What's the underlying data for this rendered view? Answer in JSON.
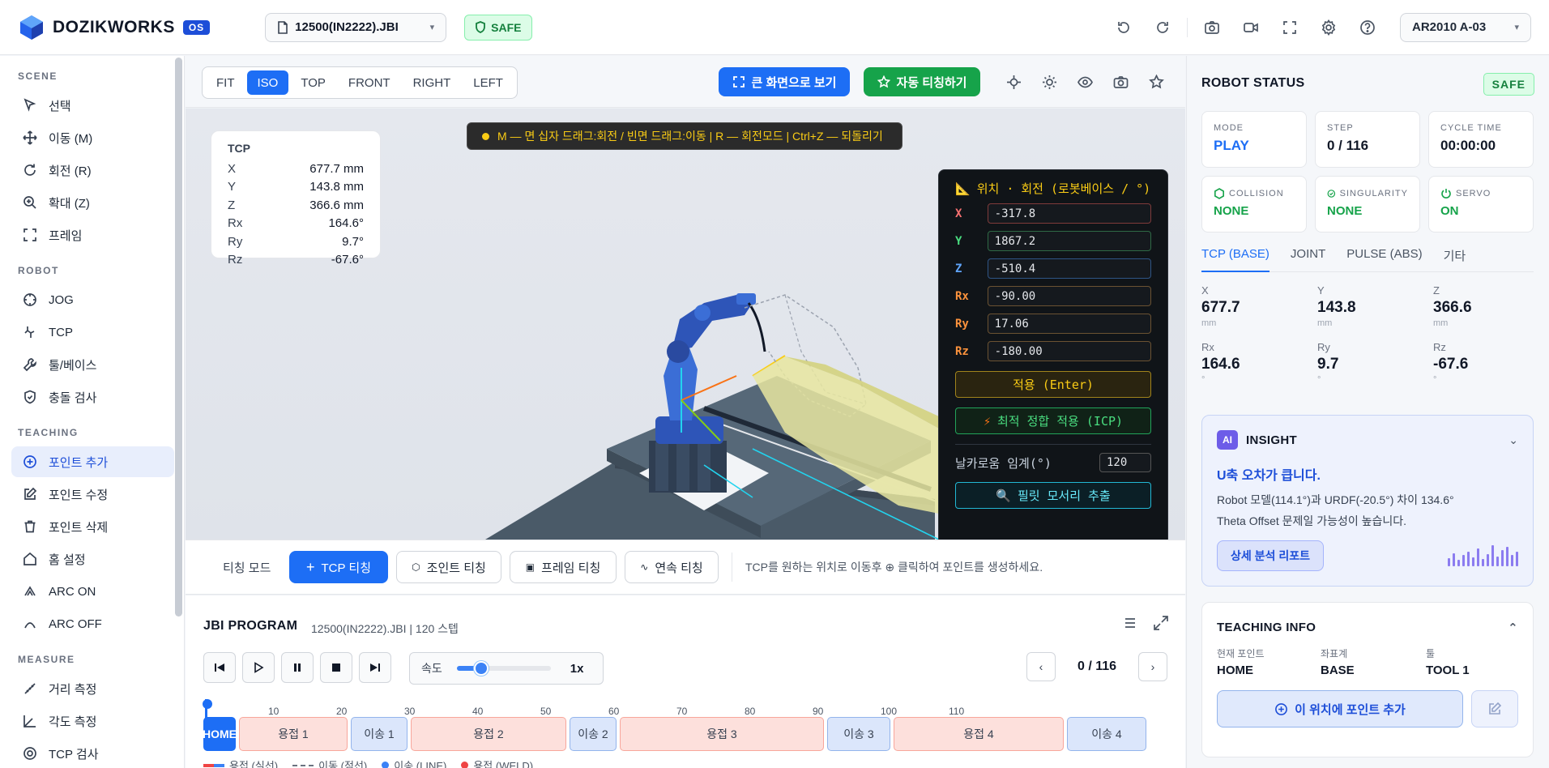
{
  "app": {
    "name": "DOZIKWORKS",
    "badge": "OS"
  },
  "header": {
    "file": "12500(IN2222).JBI",
    "status": "SAFE",
    "robot": "AR2010 A-03",
    "icons": [
      "undo-icon",
      "redo-icon",
      "camera-icon",
      "video-icon",
      "fullscreen-icon",
      "gear-icon",
      "help-icon"
    ]
  },
  "sidebar": {
    "sections": [
      {
        "title": "SCENE",
        "items": [
          {
            "label": "선택",
            "icon": "cursor-icon"
          },
          {
            "label": "이동 (M)",
            "icon": "move-icon"
          },
          {
            "label": "회전 (R)",
            "icon": "rotate-icon"
          },
          {
            "label": "확대 (Z)",
            "icon": "zoom-icon"
          },
          {
            "label": "프레임",
            "icon": "frame-icon"
          }
        ]
      },
      {
        "title": "ROBOT",
        "items": [
          {
            "label": "JOG",
            "icon": "crosshair-icon"
          },
          {
            "label": "TCP",
            "icon": "tcp-icon"
          },
          {
            "label": "툴/베이스",
            "icon": "wrench-icon"
          },
          {
            "label": "충돌 검사",
            "icon": "shield-icon"
          }
        ]
      },
      {
        "title": "TEACHING",
        "items": [
          {
            "label": "포인트 추가",
            "icon": "plus-circle-icon",
            "active": true
          },
          {
            "label": "포인트 수정",
            "icon": "edit-icon"
          },
          {
            "label": "포인트 삭제",
            "icon": "trash-icon"
          },
          {
            "label": "홈 설정",
            "icon": "home-icon"
          },
          {
            "label": "ARC ON",
            "icon": "arc-on-icon"
          },
          {
            "label": "ARC OFF",
            "icon": "arc-off-icon"
          }
        ]
      },
      {
        "title": "MEASURE",
        "items": [
          {
            "label": "거리 측정",
            "icon": "ruler-icon"
          },
          {
            "label": "각도 측정",
            "icon": "angle-icon"
          },
          {
            "label": "TCP 검사",
            "icon": "target-icon"
          }
        ]
      }
    ]
  },
  "view": {
    "tabs": [
      "FIT",
      "ISO",
      "TOP",
      "FRONT",
      "RIGHT",
      "LEFT"
    ],
    "active_tab": "ISO",
    "big_screen": "큰 화면으로 보기",
    "auto_teach": "자동 티칭하기",
    "hint": "M — 면 십자 드래그:회전 / 빈면 드래그:이동 | R — 회전모드 | Ctrl+Z — 되돌리기"
  },
  "tcp_card": {
    "title": "TCP",
    "rows": [
      {
        "k": "X",
        "v": "677.7 mm"
      },
      {
        "k": "Y",
        "v": "143.8 mm"
      },
      {
        "k": "Z",
        "v": "366.6 mm"
      },
      {
        "k": "Rx",
        "v": "164.6°"
      },
      {
        "k": "Ry",
        "v": "9.7°"
      },
      {
        "k": "Rz",
        "v": "-67.6°"
      }
    ]
  },
  "pose_panel": {
    "title": "위치 · 회전 (로봇베이스 / °)",
    "rows": [
      {
        "k": "X",
        "v": "-317.8",
        "color": "#f87171"
      },
      {
        "k": "Y",
        "v": "1867.2",
        "color": "#4ade80"
      },
      {
        "k": "Z",
        "v": "-510.4",
        "color": "#60a5fa"
      },
      {
        "k": "Rx",
        "v": "-90.00",
        "color": "#fb923c"
      },
      {
        "k": "Ry",
        "v": "17.06",
        "color": "#fb923c"
      },
      {
        "k": "Rz",
        "v": "-180.00",
        "color": "#fb923c"
      }
    ],
    "apply": "적용 (Enter)",
    "icp": "최적 정합 적용 (ICP)",
    "sharp_label": "날카로움 임계(°)",
    "sharp_value": "120",
    "extract": "필릿 모서리 추출"
  },
  "teach": {
    "mode_label": "티칭 모드",
    "buttons": [
      "TCP 티칭",
      "조인트 티칭",
      "프레임 티칭",
      "연속 티칭"
    ],
    "hint": "TCP를 원하는 위치로 이동후 ⊕ 클릭하여 포인트를 생성하세요."
  },
  "program": {
    "title": "JBI PROGRAM",
    "subtitle": "12500(IN2222).JBI | 120 스텝",
    "speed_label": "속도",
    "speed_value": 0.26,
    "speed_mult": "1x",
    "page": "0 / 116",
    "ticks": [
      "10",
      "20",
      "30",
      "40",
      "50",
      "60",
      "70",
      "80",
      "90",
      "100",
      "110"
    ],
    "segments": [
      {
        "label": "HOME",
        "kind": "home"
      },
      {
        "label": "용접 1",
        "kind": "weld"
      },
      {
        "label": "이송 1",
        "kind": "move"
      },
      {
        "label": "용접 2",
        "kind": "weld"
      },
      {
        "label": "이송 2",
        "kind": "move"
      },
      {
        "label": "용접 3",
        "kind": "weld"
      },
      {
        "label": "이송 3",
        "kind": "move"
      },
      {
        "label": "용접 4",
        "kind": "weld"
      },
      {
        "label": "이송 4",
        "kind": "move"
      }
    ],
    "legend": [
      "용접 (실선)",
      "이동 (점선)",
      "이송 (LINE)",
      "용접 (WELD)"
    ]
  },
  "status": {
    "title": "ROBOT STATUS",
    "badge": "SAFE",
    "cards": [
      {
        "label": "MODE",
        "value": "PLAY",
        "style": "blue"
      },
      {
        "label": "STEP",
        "value": "0 / 116",
        "style": ""
      },
      {
        "label": "CYCLE TIME",
        "value": "00:00:00",
        "style": ""
      },
      {
        "label": "COLLISION",
        "value": "NONE",
        "style": "green"
      },
      {
        "label": "SINGULARITY",
        "value": "NONE",
        "style": "green"
      },
      {
        "label": "SERVO",
        "value": "ON",
        "style": "green"
      }
    ],
    "tabs": [
      "TCP (BASE)",
      "JOINT",
      "PULSE (ABS)",
      "기타"
    ],
    "active_tab": 0,
    "coords": [
      {
        "k": "X",
        "v": "677.7",
        "u": "mm"
      },
      {
        "k": "Y",
        "v": "143.8",
        "u": "mm"
      },
      {
        "k": "Z",
        "v": "366.6",
        "u": "mm"
      },
      {
        "k": "Rx",
        "v": "164.6",
        "u": "°"
      },
      {
        "k": "Ry",
        "v": "9.7",
        "u": "°"
      },
      {
        "k": "Rz",
        "v": "-67.6",
        "u": "°"
      }
    ]
  },
  "insight": {
    "badge": "AI",
    "title": "INSIGHT",
    "headline": "U축 오차가 큽니다.",
    "line1": "Robot 모델(114.1°)과 URDF(-20.5°) 차이 134.6°",
    "line2": "Theta Offset 문제일 가능성이 높습니다.",
    "button": "상세 분석 리포트"
  },
  "teaching_info": {
    "title": "TEACHING INFO",
    "fields": [
      {
        "k": "현재 포인트",
        "v": "HOME"
      },
      {
        "k": "좌표계",
        "v": "BASE"
      },
      {
        "k": "툴",
        "v": "TOOL 1"
      }
    ],
    "add_button": "이 위치에 포인트 추가"
  }
}
